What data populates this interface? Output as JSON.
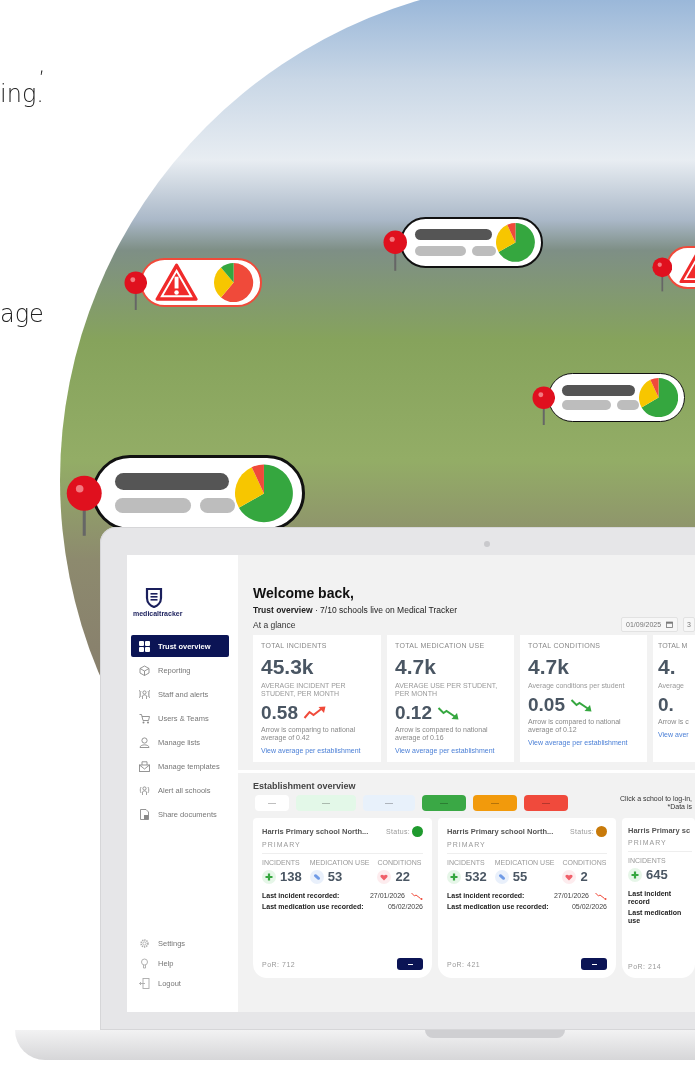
{
  "intro_text_fragments": [
    ",",
    "ing.",
    "age"
  ],
  "map_markers": [
    {
      "kind": "summary"
    },
    {
      "kind": "alert"
    },
    {
      "kind": "alert"
    },
    {
      "kind": "summary"
    },
    {
      "kind": "summary"
    }
  ],
  "app": {
    "logo_text": "medicaltracker",
    "nav": [
      {
        "label": "Trust overview",
        "selected": true
      },
      {
        "label": "Reporting",
        "selected": false
      },
      {
        "label": "Staff and alerts",
        "selected": false
      },
      {
        "label": "Users & Teams",
        "selected": false
      },
      {
        "label": "Manage lists",
        "selected": false
      },
      {
        "label": "Manage templates",
        "selected": false
      },
      {
        "label": "Alert all schools",
        "selected": false
      },
      {
        "label": "Share documents",
        "selected": false
      }
    ],
    "footer_nav": [
      {
        "label": "Settings"
      },
      {
        "label": "Help"
      },
      {
        "label": "Logout"
      }
    ],
    "greeting": "Welcome back,",
    "subtitle": "**Trust overview** · 7/10 schools live on Medical Tracker",
    "section_title": "At a glance",
    "date_fields": [
      {
        "value": "01/09/2025"
      },
      {
        "value": "3"
      }
    ],
    "stat_cards": [
      {
        "label": "TOTAL INCIDENTS",
        "value": "45.3k",
        "sublabel": "AVERAGE INCIDENT PER STUDENT, PER MONTH",
        "ratio": "0.58",
        "kind": "up",
        "note": "Arrow is comparing to national average of 0.42",
        "link": "View average per establishment"
      },
      {
        "label": "TOTAL MEDICATION USE",
        "value": "4.7k",
        "sublabel": "AVERAGE USE PER STUDENT, PER MONTH",
        "ratio": "0.12",
        "kind": "down",
        "note": "Arrow is compared to national average of 0.16",
        "link": "View average per establishment"
      },
      {
        "label": "TOTAL CONDITIONS",
        "value": "4.7k",
        "sublabel": "Average conditions per student",
        "ratio": "0.05",
        "kind": "down",
        "note": "Arrow is compared to national average of 0.12",
        "link": "View average per establishment"
      },
      {
        "label": "TOTAL M",
        "value": "4.",
        "sublabel": "Average",
        "ratio": "0.",
        "kind": "plain",
        "note": "Arrow is c",
        "link": "View aver"
      }
    ],
    "establishment_title": "Establishment overview",
    "filter_chips": [
      {
        "color": "#ffffff"
      },
      {
        "color": "#e3f8e8"
      },
      {
        "color": "#e8f1fb"
      },
      {
        "color": "#3aa845"
      },
      {
        "color": "#f29a0c"
      },
      {
        "color": "#f04a3c"
      }
    ],
    "hint_lines": [
      "Click a school to log-in,",
      "*Data is"
    ],
    "school_cards": [
      {
        "name": "Harris Primary school North...",
        "status_label": "Status:",
        "color": "#1f9a2e",
        "type": "PRIMARY",
        "stats": [
          {
            "kind": "incidents",
            "label": "INCIDENTS",
            "value": "138"
          },
          {
            "kind": "medication",
            "label": "MEDICATION USE",
            "value": "53"
          },
          {
            "kind": "conditions",
            "label": "CONDITIONS",
            "value": "22"
          }
        ],
        "last_rows": [
          {
            "label": "Last incident recorded:",
            "date": "27/01/2026",
            "kind": "trend"
          },
          {
            "label": "Last medication use recorded:",
            "date": "05/02/2026",
            "kind": "plain"
          }
        ],
        "por": "PoR: 712",
        "has_button": true
      },
      {
        "name": "Harris Primary school North...",
        "status_label": "Status:",
        "color": "#c87a0a",
        "type": "PRIMARY",
        "stats": [
          {
            "kind": "incidents",
            "label": "INCIDENTS",
            "value": "532"
          },
          {
            "kind": "medication",
            "label": "MEDICATION USE",
            "value": "55"
          },
          {
            "kind": "conditions",
            "label": "CONDITIONS",
            "value": "2"
          }
        ],
        "last_rows": [
          {
            "label": "Last incident recorded:",
            "date": "27/01/2026",
            "kind": "trend"
          },
          {
            "label": "Last medication use recorded:",
            "date": "05/02/2026",
            "kind": "plain"
          }
        ],
        "por": "PoR: 421",
        "has_button": true
      },
      {
        "name": "Harris Primary sc",
        "type": "PRIMARY",
        "stats": [
          {
            "kind": "incidents",
            "label": "INCIDENTS",
            "value": "645"
          }
        ],
        "last_rows": [
          {
            "label": "Last incident record",
            "kind": "plain"
          },
          {
            "label": "Last medication use",
            "kind": "plain"
          }
        ],
        "por": "PoR: 214",
        "has_button": false
      }
    ]
  }
}
